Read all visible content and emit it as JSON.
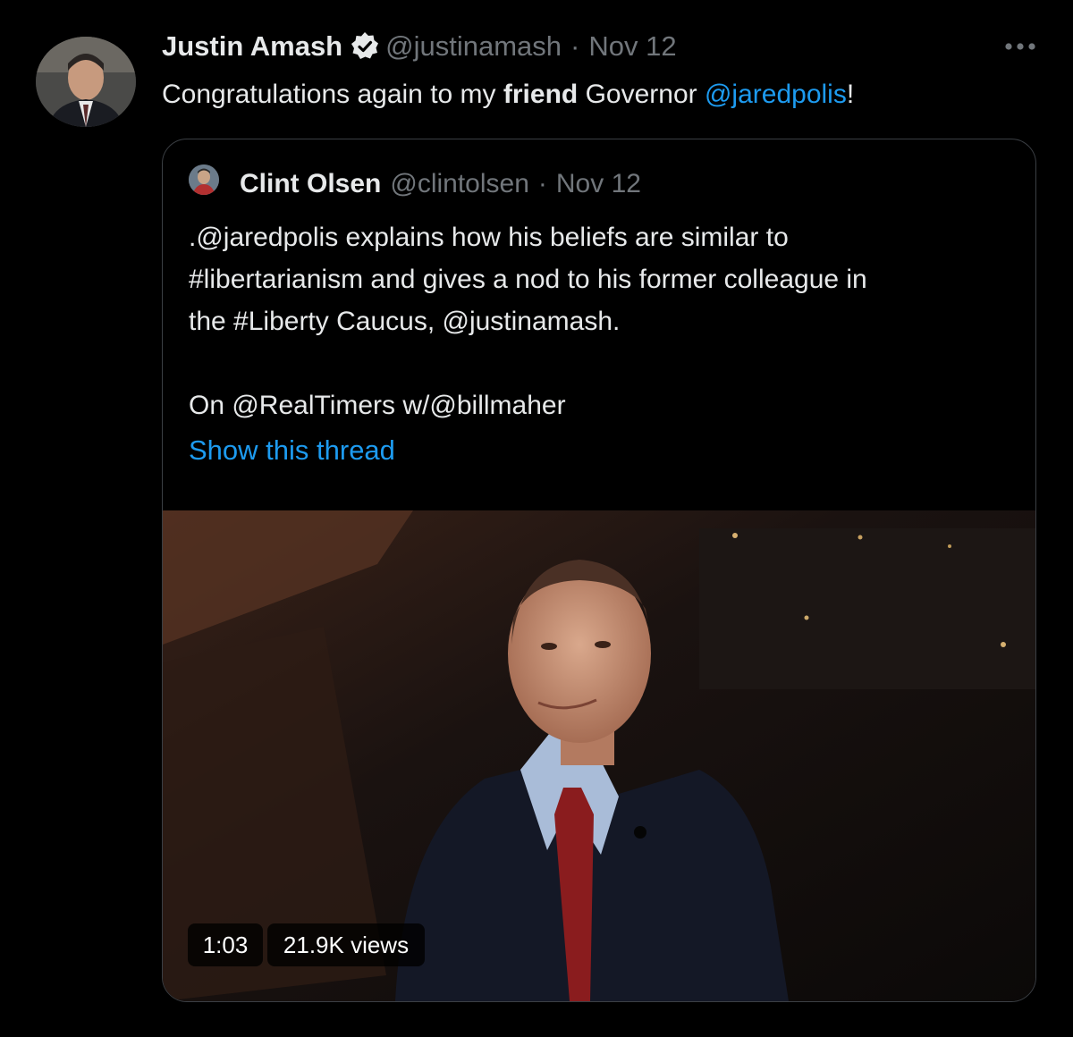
{
  "tweet": {
    "author_name": "Justin Amash",
    "handle": "@justinamash",
    "separator": "·",
    "date": "Nov 12",
    "text_before": "Congratulations again to my ",
    "text_bold": "friend",
    "text_middle": " Governor ",
    "mention": "@jaredpolis",
    "text_after": "!"
  },
  "quote": {
    "author_name": "Clint Olsen",
    "handle": "@clintolsen",
    "separator": "·",
    "date": "Nov 12",
    "lines": [
      ".@jaredpolis explains how his beliefs are similar to",
      "#libertarianism and gives a nod to his former colleague in",
      "the #Liberty Caucus, @justinamash."
    ],
    "line_extra": "On @RealTimers w/@billmaher",
    "show_thread": "Show this thread",
    "video": {
      "duration": "1:03",
      "views": "21.9K views"
    }
  },
  "icons": {
    "verified": "verified-badge-icon",
    "more": "more-options-icon"
  },
  "colors": {
    "background": "#000000",
    "text": "#e7e9ea",
    "muted": "#71767b",
    "link": "#1d9bf0",
    "border": "#3b3f44"
  }
}
